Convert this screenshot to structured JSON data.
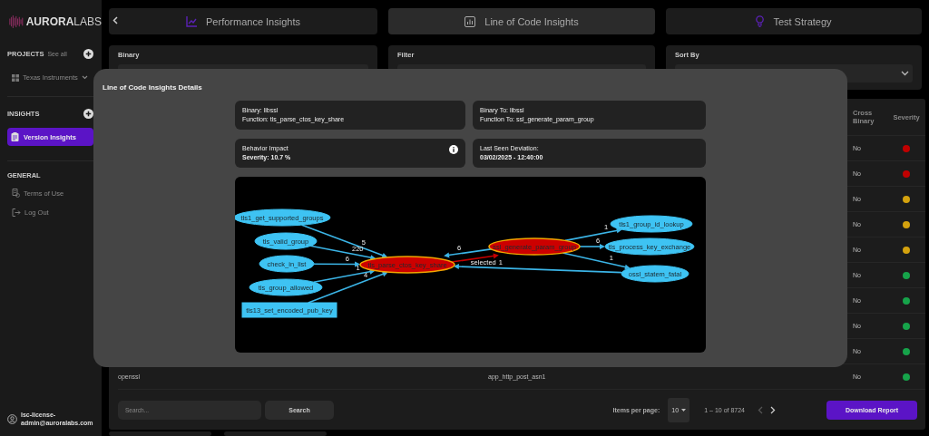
{
  "sidebar": {
    "logo": "**AURORA**LABS",
    "projects": {
      "title": "PROJECTS",
      "link": "See all",
      "project": "Texas Instruments"
    },
    "insights": {
      "title": "INSIGHTS",
      "items": [
        {
          "label": "Version Insights",
          "selected": true
        }
      ]
    },
    "general": {
      "title": "GENERAL",
      "items": [
        {
          "label": "Terms of Use",
          "kind": "terms"
        },
        {
          "label": "Log Out",
          "kind": "logout"
        }
      ]
    },
    "user": "lsc-license-admin@auroralabs.com"
  },
  "tabs": [
    {
      "label": "Performance Insights",
      "kind": "performance",
      "selected": false
    },
    {
      "label": "Line of Code Insights",
      "kind": "code",
      "selected": true
    },
    {
      "label": "Test Strategy",
      "kind": "strategy",
      "selected": false
    }
  ],
  "filters": [
    {
      "label": "Binary",
      "kind": "input"
    },
    {
      "label": "Filter",
      "kind": "input"
    },
    {
      "label": "Sort By",
      "kind": "select"
    }
  ],
  "table": {
    "columns": [
      "Cross Binary",
      "Severity"
    ],
    "rows": [
      {
        "cross_binary": "No",
        "color": "#c00000"
      },
      {
        "cross_binary": "No",
        "color": "#c00000"
      },
      {
        "cross_binary": "No",
        "color": "#d4a20e"
      },
      {
        "cross_binary": "No",
        "color": "#d4a20e"
      },
      {
        "cross_binary": "No",
        "color": "#d4a20e"
      },
      {
        "cross_binary": "No",
        "color": "#16a34a"
      },
      {
        "cross_binary": "No",
        "color": "#16a34a"
      },
      {
        "cross_binary": "No",
        "color": "#16a34a"
      },
      {
        "cross_binary": "No",
        "color": "#16a34a"
      },
      {
        "column_1": "openssl",
        "column_2": "app_http_post_asn1",
        "cross_binary": "No",
        "color": "#16a34a"
      }
    ]
  },
  "footer": {
    "search": {
      "placeholder": "Search..."
    },
    "search_button": "Search",
    "items_per_page_label": "Items per page:",
    "items_per_page": "10",
    "range": "1 – 10 of 8724",
    "prev_disabled": true,
    "next_disabled": false,
    "download_button": "Download Report"
  },
  "modal": {
    "title": "Line of Code Insights Details",
    "cards": [
      {
        "title": "Binary: libssl",
        "detail": "Function: tls_parse_ctos_key_share",
        "emphasis": false,
        "info": false
      },
      {
        "title": "Binary To: libssl",
        "detail": "Function To: ssl_generate_param_group",
        "emphasis": false,
        "info": false
      },
      {
        "title": "Behavior Impact",
        "detail": "Severity: 10.7 %",
        "emphasis": true,
        "info": true
      },
      {
        "title": "Last Seen Deviation:",
        "detail": "03/02/2025 - 12:40:00",
        "emphasis": true,
        "info": false
      }
    ],
    "graph": {
      "nodes": [
        {
          "label": "tls1_get_supported_groups",
          "kind": "ellipse",
          "highlighted": false
        },
        {
          "label": "tls_valid_group",
          "kind": "ellipse",
          "highlighted": false
        },
        {
          "label": "check_in_list",
          "kind": "ellipse",
          "highlighted": false
        },
        {
          "label": "tls_group_allowed",
          "kind": "ellipse",
          "highlighted": false
        },
        {
          "label": "tls13_set_encoded_pub_key",
          "kind": "box",
          "highlighted": false
        },
        {
          "label": "tls_parse_ctos_key_share",
          "kind": "ellipse",
          "highlighted": true
        },
        {
          "label": "ssl_generate_param_group",
          "kind": "ellipse",
          "highlighted": true
        },
        {
          "label": "tls1_group_id_lookup",
          "kind": "ellipse",
          "highlighted": false
        },
        {
          "label": "tls_process_key_exchange",
          "kind": "ellipse",
          "highlighted": false
        },
        {
          "label": "ossl_statem_fatal",
          "kind": "ellipse",
          "highlighted": false
        }
      ],
      "edges": [
        {
          "label": "5",
          "selected": false
        },
        {
          "label": "220",
          "selected": false
        },
        {
          "label": "6",
          "selected": false
        },
        {
          "label": "1",
          "selected": false
        },
        {
          "label": "4",
          "selected": false
        },
        {
          "label": "6",
          "selected": false
        },
        {
          "label": "selected",
          "selected": true
        },
        {
          "label": "1",
          "selected": false
        },
        {
          "label": "6",
          "selected": false
        },
        {
          "label": "1",
          "selected": false
        },
        {
          "label": "1",
          "selected": false
        }
      ]
    }
  }
}
